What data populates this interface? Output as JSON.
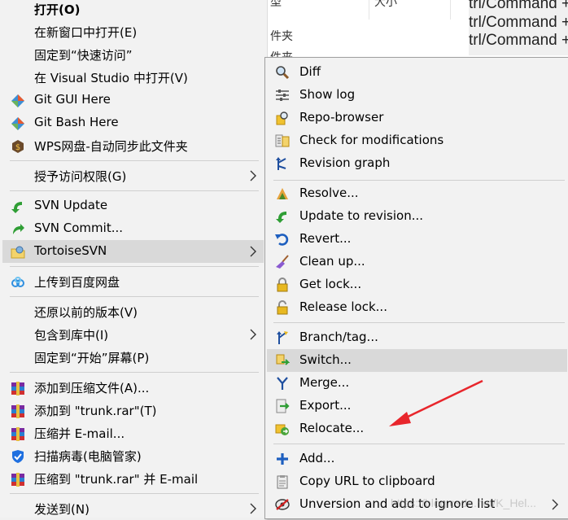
{
  "background": {
    "col1_header": "型",
    "col2_header": "大小",
    "row1_type": "件夹",
    "row2_type": "件夹",
    "cmd_lines": [
      "trl/Command +",
      "trl/Command +",
      "trl/Command +"
    ]
  },
  "context_menu": {
    "items": [
      {
        "label": "打开(O)"
      },
      {
        "label": "在新窗口中打开(E)"
      },
      {
        "label": "固定到“快速访问”"
      },
      {
        "label": "在 Visual Studio 中打开(V)"
      },
      {
        "label": "Git GUI Here"
      },
      {
        "label": "Git Bash Here"
      },
      {
        "label": "WPS网盘-自动同步此文件夹"
      },
      {
        "label": "授予访问权限(G)"
      },
      {
        "label": "SVN Update"
      },
      {
        "label": "SVN Commit..."
      },
      {
        "label": "TortoiseSVN"
      },
      {
        "label": "上传到百度网盘"
      },
      {
        "label": "还原以前的版本(V)"
      },
      {
        "label": "包含到库中(I)"
      },
      {
        "label": "固定到“开始”屏幕(P)"
      },
      {
        "label": "添加到压缩文件(A)..."
      },
      {
        "label": "添加到 \"trunk.rar\"(T)"
      },
      {
        "label": "压缩并 E-mail..."
      },
      {
        "label": "扫描病毒(电脑管家)"
      },
      {
        "label": "压缩到 \"trunk.rar\" 并 E-mail"
      },
      {
        "label": "发送到(N)"
      }
    ]
  },
  "tortoise_submenu": {
    "items": [
      {
        "label": "Diff"
      },
      {
        "label": "Show log"
      },
      {
        "label": "Repo-browser"
      },
      {
        "label": "Check for modifications"
      },
      {
        "label": "Revision graph"
      },
      {
        "label": "Resolve..."
      },
      {
        "label": "Update to revision..."
      },
      {
        "label": "Revert..."
      },
      {
        "label": "Clean up..."
      },
      {
        "label": "Get lock..."
      },
      {
        "label": "Release lock..."
      },
      {
        "label": "Branch/tag..."
      },
      {
        "label": "Switch..."
      },
      {
        "label": "Merge..."
      },
      {
        "label": "Export..."
      },
      {
        "label": "Relocate..."
      },
      {
        "label": "Add..."
      },
      {
        "label": "Copy URL to clipboard"
      },
      {
        "label": "Unversion and add to ignore list"
      }
    ]
  },
  "annotation_color": "#e8262c",
  "highlight_color": "#d9d9d9",
  "watermark": "https://blog.csdn.net/K_Hel..."
}
